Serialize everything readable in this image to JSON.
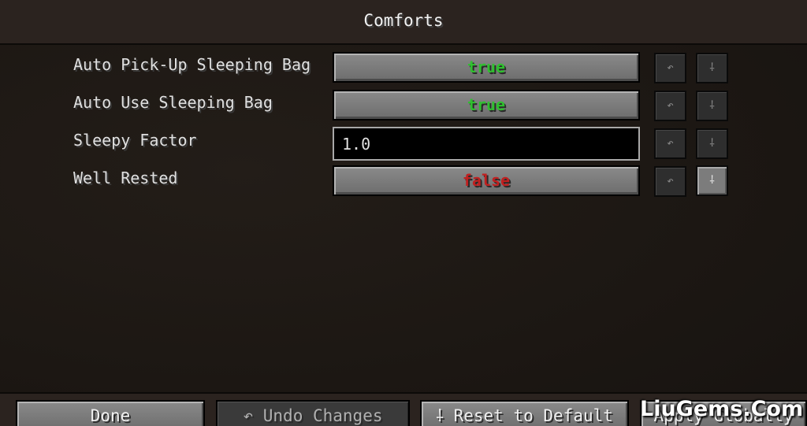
{
  "screen": {
    "title": "Comforts"
  },
  "settings": [
    {
      "label": "Auto Pick-Up Sleeping Bag",
      "value": "true",
      "type": "toggle",
      "undo_icon": "↶",
      "reset_icon": "⸸"
    },
    {
      "label": "Auto Use Sleeping Bag",
      "value": "true",
      "type": "toggle",
      "undo_icon": "↶",
      "reset_icon": "⸸"
    },
    {
      "label": "Sleepy Factor",
      "value": "1.0",
      "type": "text",
      "undo_icon": "↶",
      "reset_icon": "⸸"
    },
    {
      "label": "Well Rested",
      "value": "false",
      "type": "toggle",
      "undo_icon": "↶",
      "reset_icon": "⸸"
    }
  ],
  "footer": {
    "done_label": "Done",
    "undo_label": "↶ Undo Changes",
    "reset_label": "⸸ Reset to Default",
    "apply_label": "Apply Globally"
  },
  "watermark": {
    "text": "LiuGems.Com"
  },
  "colors": {
    "true": "#2fbf2f",
    "false": "#c02020"
  },
  "icons": {
    "undo": "undo-arrow-icon",
    "reset": "reset-default-icon"
  }
}
